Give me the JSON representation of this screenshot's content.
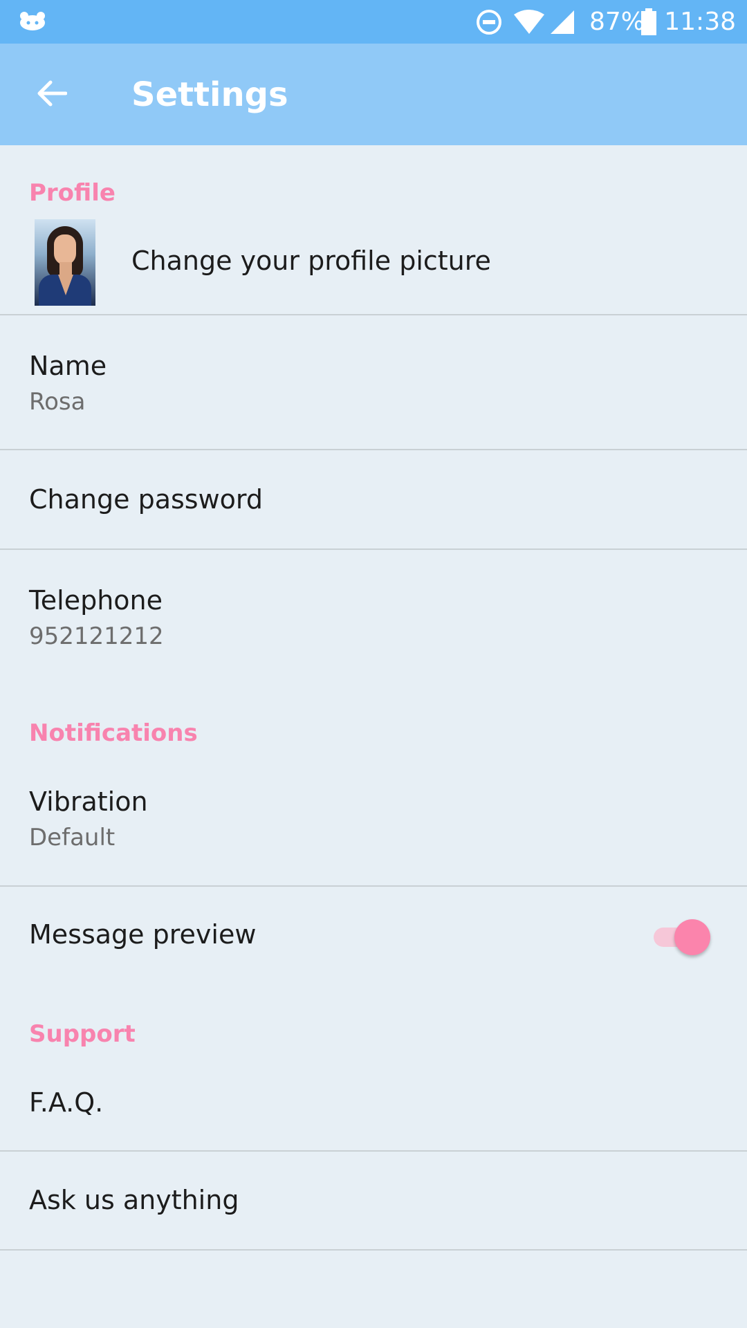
{
  "status_bar": {
    "battery_percent": "87%",
    "time": "11:38",
    "icons": [
      "app-notification-icon",
      "do-not-disturb-icon",
      "wifi-icon",
      "cell-signal-icon",
      "battery-icon"
    ]
  },
  "app_bar": {
    "title": "Settings",
    "back_icon": "arrow-back-icon"
  },
  "sections": {
    "profile": {
      "header": "Profile",
      "change_picture": "Change your profile picture",
      "name_label": "Name",
      "name_value": "Rosa",
      "change_password": "Change password",
      "telephone_label": "Telephone",
      "telephone_value": "952121212"
    },
    "notifications": {
      "header": "Notifications",
      "vibration_label": "Vibration",
      "vibration_value": "Default",
      "message_preview_label": "Message preview",
      "message_preview_enabled": true
    },
    "support": {
      "header": "Support",
      "faq": "F.A.Q.",
      "ask": "Ask us anything"
    }
  },
  "colors": {
    "status_bar": "#63b5f5",
    "app_bar": "#90c9f7",
    "background": "#e7eff5",
    "accent": "#f883ae"
  }
}
